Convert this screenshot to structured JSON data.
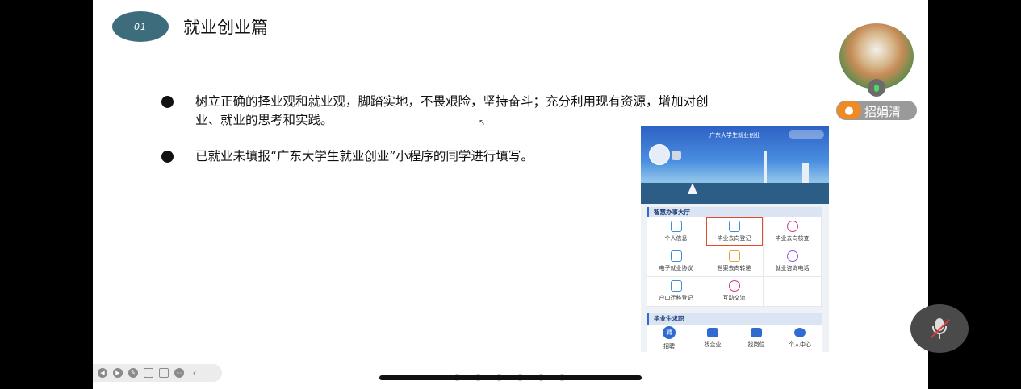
{
  "slide": {
    "badge": "01",
    "title": "就业创业篇",
    "bullets": [
      {
        "line1": "树立正确的择业观和就业观，脚踏实地，不畏艰险，坚持奋斗；充分利用现有资源，增加对创",
        "line2": "业、就业的思考和实践。"
      },
      {
        "line1": "已就业未填报“广东大学生就业创业”小程序的同学进行填写。",
        "line2": ""
      }
    ]
  },
  "mock": {
    "app_title": "广东大学生就业创业",
    "section1": "智慧办事大厅",
    "services": [
      {
        "label": "个人信息",
        "icon": "person-doc-icon",
        "highlight": false
      },
      {
        "label": "毕业去向登记",
        "icon": "briefcase-icon",
        "highlight": true
      },
      {
        "label": "毕业去向核查",
        "icon": "check-icon",
        "highlight": false
      },
      {
        "label": "电子就业协议",
        "icon": "document-icon",
        "highlight": false
      },
      {
        "label": "档案去向转递",
        "icon": "archive-icon",
        "highlight": false
      },
      {
        "label": "就业咨询电话",
        "icon": "phone-icon",
        "highlight": false
      },
      {
        "label": "户口迁移登记",
        "icon": "list-icon",
        "highlight": false
      },
      {
        "label": "互动交流",
        "icon": "headset-icon",
        "highlight": false
      },
      {
        "label": "",
        "icon": "",
        "highlight": false
      }
    ],
    "section2": "毕业生求职",
    "jobs": [
      {
        "label": "招聘",
        "icon": "recruit-icon",
        "glyph": "聘"
      },
      {
        "label": "找企业",
        "icon": "building-icon",
        "glyph": ""
      },
      {
        "label": "找岗位",
        "icon": "briefcase-icon",
        "glyph": ""
      },
      {
        "label": "个人中心",
        "icon": "user-icon",
        "glyph": ""
      }
    ]
  },
  "participant": {
    "name": "招娟清",
    "mic_color": "#4cd964"
  },
  "colors": {
    "badge": "#3d6d7d",
    "highlight_border": "#e34a2a",
    "accent_blue": "#2f6bd0",
    "name_icon": "#f08a24"
  }
}
